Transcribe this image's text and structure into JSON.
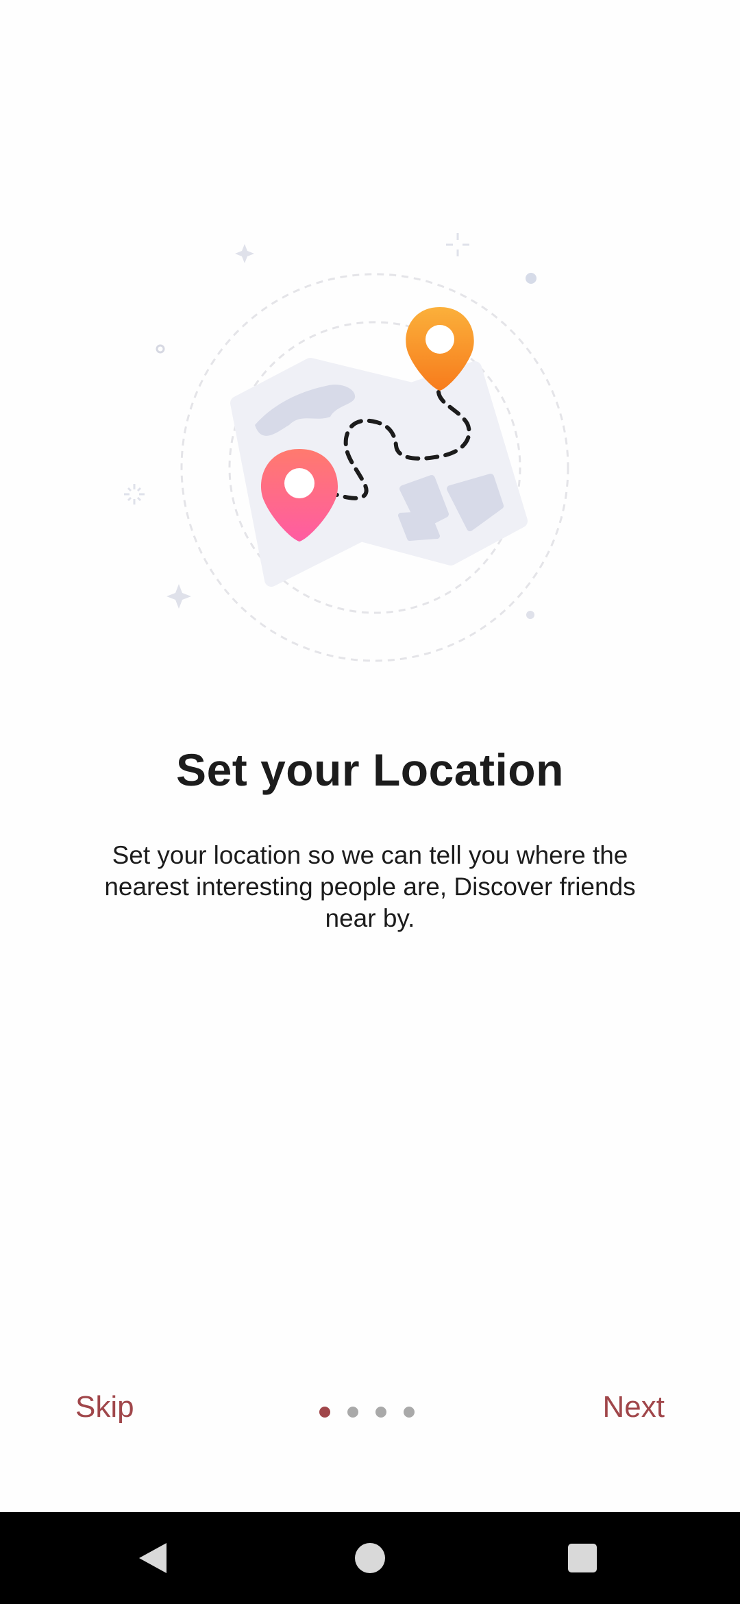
{
  "onboarding": {
    "title": "Set your Location",
    "description": "Set your location so we can tell you where the nearest interesting people are, Discover friends near by.",
    "illustration_icon": "map-with-location-pins",
    "page_count": 4,
    "active_page": 1
  },
  "controls": {
    "skip_label": "Skip",
    "next_label": "Next"
  },
  "system_nav": {
    "back_icon": "triangle-back-icon",
    "home_icon": "circle-home-icon",
    "recents_icon": "square-recents-icon"
  },
  "colors": {
    "accent": "#a0464a",
    "title_text": "#1c1c1c",
    "dot_inactive": "#a9a9a9",
    "pin_pink": "#ff5f8a",
    "pin_orange": "#f98a1c",
    "map_paper": "#eff0f6",
    "nav_bar": "#000000"
  }
}
